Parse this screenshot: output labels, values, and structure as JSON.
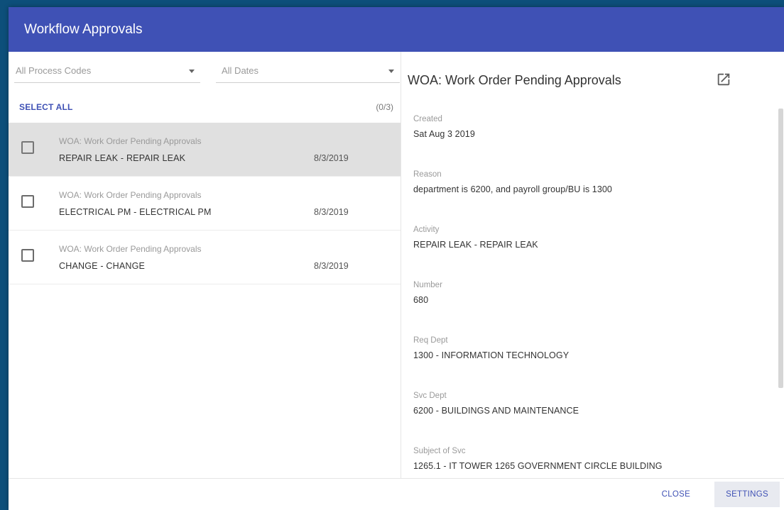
{
  "dialog": {
    "title": "Workflow Approvals"
  },
  "filters": {
    "process_codes": "All Process Codes",
    "dates": "All Dates"
  },
  "list_header": {
    "select_all": "SELECT ALL",
    "count": "(0/3)"
  },
  "items": [
    {
      "subtitle": "WOA: Work Order Pending Approvals",
      "title": "REPAIR LEAK - REPAIR LEAK",
      "date": "8/3/2019",
      "selected": true,
      "checked": false
    },
    {
      "subtitle": "WOA: Work Order Pending Approvals",
      "title": "ELECTRICAL PM - ELECTRICAL PM",
      "date": "8/3/2019",
      "selected": false,
      "checked": false
    },
    {
      "subtitle": "WOA: Work Order Pending Approvals",
      "title": "CHANGE - CHANGE",
      "date": "8/3/2019",
      "selected": false,
      "checked": false
    }
  ],
  "detail": {
    "title": "WOA: Work Order Pending Approvals",
    "open_icon": "open-in-new-icon",
    "fields": [
      {
        "label": "Created",
        "value": "Sat Aug 3 2019"
      },
      {
        "label": "Reason",
        "value": "department is 6200, and payroll group/BU is 1300"
      },
      {
        "label": "Activity",
        "value": "REPAIR LEAK - REPAIR LEAK"
      },
      {
        "label": "Number",
        "value": "680"
      },
      {
        "label": "Req Dept",
        "value": "1300 - INFORMATION TECHNOLOGY"
      },
      {
        "label": "Svc Dept",
        "value": "6200 - BUILDINGS AND MAINTENANCE"
      },
      {
        "label": "Subject of Svc",
        "value": "1265.1 - IT TOWER 1265 GOVERNMENT CIRCLE BUILDING"
      }
    ]
  },
  "footer": {
    "close_label": "CLOSE",
    "settings_label": "SETTINGS"
  },
  "colors": {
    "header": "#3f51b5",
    "accent": "#3f51b5",
    "selected_row": "#e0e0e0"
  }
}
